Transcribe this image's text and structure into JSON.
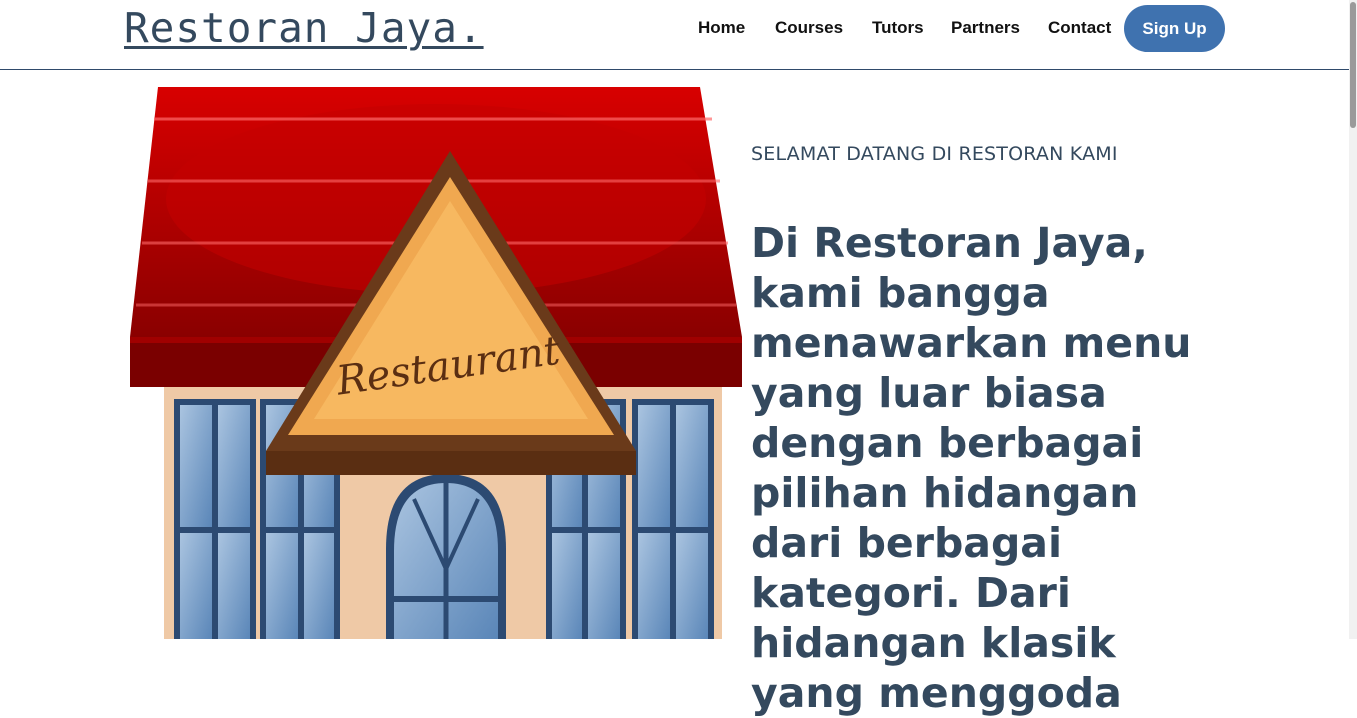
{
  "header": {
    "brand": "Restoran Jaya.",
    "nav": [
      {
        "label": "Home"
      },
      {
        "label": "Courses"
      },
      {
        "label": "Tutors"
      },
      {
        "label": "Partners"
      },
      {
        "label": "Contact"
      }
    ],
    "signup_label": "Sign Up"
  },
  "hero": {
    "image_sign_text": "Restaurant",
    "welcome": "SELAMAT DATANG DI RESTORAN KAMI",
    "description": "Di Restoran Jaya, kami bangga menawarkan menu yang luar biasa dengan berbagai pilihan hidangan dari berbagai kategori. Dari hidangan klasik yang menggoda"
  },
  "colors": {
    "accent": "#3f72af",
    "text": "#34495e",
    "roof": "#b30000",
    "sign": "#f0a850"
  }
}
